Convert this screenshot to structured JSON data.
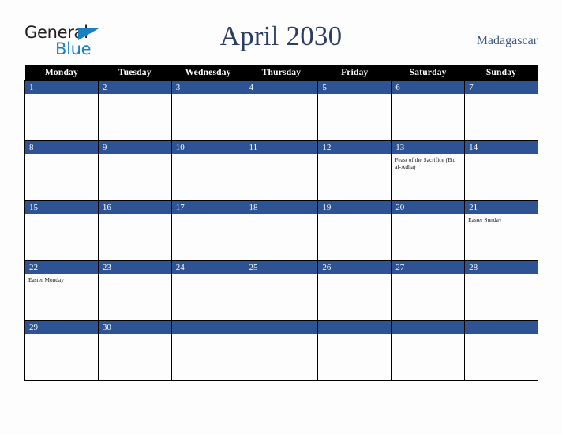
{
  "logo": {
    "word_general": "General",
    "word_blue": "Blue",
    "triangle_icon": "blue-triangle-icon",
    "general_color": "#231f20",
    "blue_color": "#1b7fc4"
  },
  "header": {
    "title": "April 2030",
    "country": "Madagascar",
    "title_color": "#2b3d63",
    "country_color": "#3c5480"
  },
  "calendar": {
    "weekday_headers": [
      "Monday",
      "Tuesday",
      "Wednesday",
      "Thursday",
      "Friday",
      "Saturday",
      "Sunday"
    ],
    "header_bg": "#000000",
    "header_text_color": "#ffffff",
    "daynum_bg": "#2d5394",
    "daynum_text_color": "#ffffff",
    "cell_bg": "#fdfdfd",
    "grid_color": "#000000",
    "weeks": [
      [
        {
          "day": "1",
          "events": []
        },
        {
          "day": "2",
          "events": []
        },
        {
          "day": "3",
          "events": []
        },
        {
          "day": "4",
          "events": []
        },
        {
          "day": "5",
          "events": []
        },
        {
          "day": "6",
          "events": []
        },
        {
          "day": "7",
          "events": []
        }
      ],
      [
        {
          "day": "8",
          "events": []
        },
        {
          "day": "9",
          "events": []
        },
        {
          "day": "10",
          "events": []
        },
        {
          "day": "11",
          "events": []
        },
        {
          "day": "12",
          "events": []
        },
        {
          "day": "13",
          "events": [
            "Feast of the Sacrifice (Eid al-Adha)"
          ]
        },
        {
          "day": "14",
          "events": []
        }
      ],
      [
        {
          "day": "15",
          "events": []
        },
        {
          "day": "16",
          "events": []
        },
        {
          "day": "17",
          "events": []
        },
        {
          "day": "18",
          "events": []
        },
        {
          "day": "19",
          "events": []
        },
        {
          "day": "20",
          "events": []
        },
        {
          "day": "21",
          "events": [
            "Easter Sunday"
          ]
        }
      ],
      [
        {
          "day": "22",
          "events": [
            "Easter Monday"
          ]
        },
        {
          "day": "23",
          "events": []
        },
        {
          "day": "24",
          "events": []
        },
        {
          "day": "25",
          "events": []
        },
        {
          "day": "26",
          "events": []
        },
        {
          "day": "27",
          "events": []
        },
        {
          "day": "28",
          "events": []
        }
      ],
      [
        {
          "day": "29",
          "events": []
        },
        {
          "day": "30",
          "events": []
        },
        {
          "day": "",
          "events": []
        },
        {
          "day": "",
          "events": []
        },
        {
          "day": "",
          "events": []
        },
        {
          "day": "",
          "events": []
        },
        {
          "day": "",
          "events": []
        }
      ]
    ]
  }
}
